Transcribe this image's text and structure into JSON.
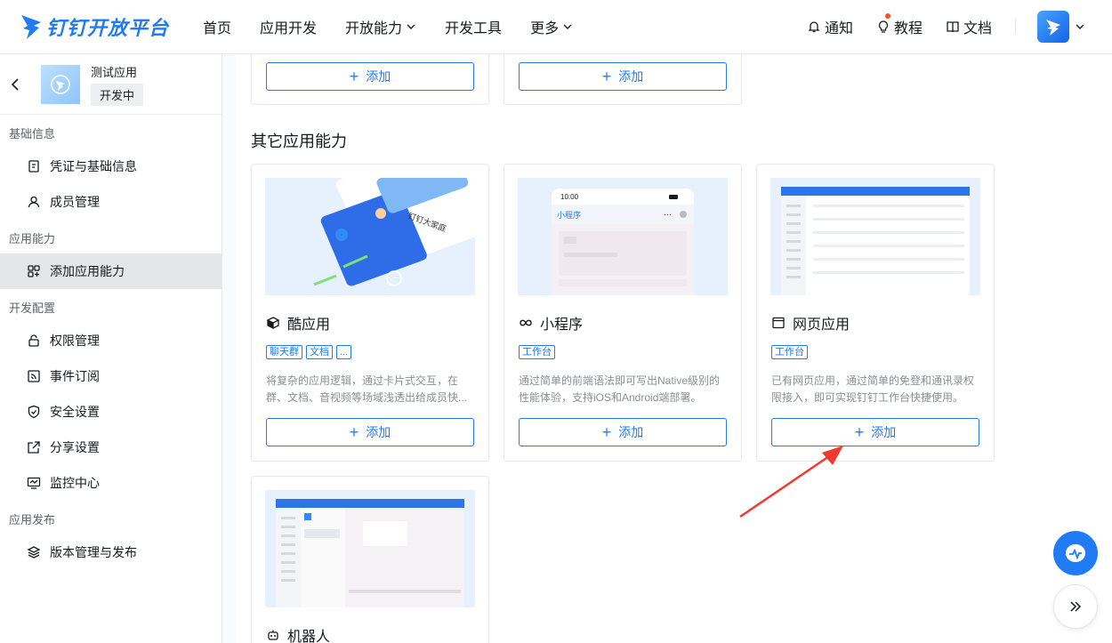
{
  "brand": {
    "name": "钉钉开放平台",
    "color": "#1f7cf5"
  },
  "nav": {
    "items": [
      {
        "label": "首页"
      },
      {
        "label": "应用开发"
      },
      {
        "label": "开放能力"
      },
      {
        "label": "开发工具"
      },
      {
        "label": "更多"
      }
    ],
    "right": {
      "notify": "通知",
      "tutorial": "教程",
      "docs": "文档"
    }
  },
  "sidebar": {
    "app_name": "测试应用",
    "app_status": "开发中",
    "sections": [
      {
        "title": "基础信息",
        "items": [
          "凭证与基础信息",
          "成员管理"
        ]
      },
      {
        "title": "应用能力",
        "items": [
          "添加应用能力"
        ]
      },
      {
        "title": "开发配置",
        "items": [
          "权限管理",
          "事件订阅",
          "安全设置",
          "分享设置",
          "监控中心"
        ]
      },
      {
        "title": "应用发布",
        "items": [
          "版本管理与发布"
        ]
      }
    ],
    "active_item": "添加应用能力"
  },
  "main": {
    "add_label": "添加",
    "section_title": "其它应用能力",
    "cards": [
      {
        "title": "酷应用",
        "icon": "cool-app-icon",
        "tags": [
          "聊天群",
          "文档",
          "..."
        ],
        "desc": "将复杂的应用逻辑，通过卡片式交互，在群、文档、音视频等场域浅透出给成员快...",
        "preview": {
          "banner": "钉钉大家庭"
        }
      },
      {
        "title": "小程序",
        "icon": "mini-program-icon",
        "tags": [
          "工作台"
        ],
        "desc": "通过简单的前端语法即可写出Native级别的性能体验，支持iOS和Android端部署。",
        "preview": {
          "time": "10:00",
          "title": "小程序"
        }
      },
      {
        "title": "网页应用",
        "icon": "web-app-icon",
        "tags": [
          "工作台"
        ],
        "desc": "已有网页应用，通过简单的免登和通讯录权限接入，即可实现钉钉工作台快捷使用。"
      },
      {
        "title": "机器人",
        "icon": "robot-icon",
        "tags": [],
        "desc": ""
      }
    ]
  },
  "colors": {
    "accent": "#1f7cf5",
    "arrow": "#f03a2e",
    "sidebar_active": "#e5e6e8"
  }
}
